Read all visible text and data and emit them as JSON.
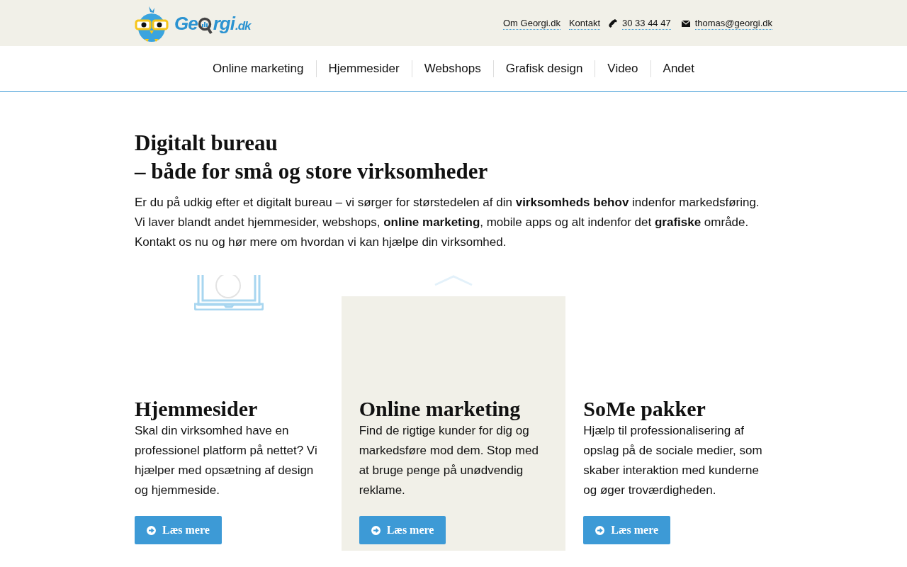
{
  "header": {
    "logo": {
      "before": "Ge",
      "after": "rgi",
      "suffix": ".dk"
    },
    "links": [
      {
        "kind": "link",
        "label": "Om Georgi.dk"
      },
      {
        "kind": "link",
        "label": "Kontakt"
      },
      {
        "kind": "phone",
        "label": "30 33 44 47"
      },
      {
        "kind": "email",
        "label": "thomas@georgi.dk"
      }
    ]
  },
  "nav": [
    "Online marketing",
    "Hjemmesider",
    "Webshops",
    "Grafisk design",
    "Video",
    "Andet"
  ],
  "intro": {
    "title_lines": [
      "Digitalt bureau",
      "– både for små og store virksomheder"
    ],
    "text": "Er du på udkig efter et digitalt bureau – vi sørger for størstedelen af din **virksomheds behov** indenfor markedsføring. Vi laver blandt andet hjemmesider, webshops, **online marketing**, mobile apps og alt indenfor det **grafiske** område. Kontakt os nu og hør mere om hvordan vi kan hjælpe din virksomhed."
  },
  "cards": [
    {
      "kind": "laptop",
      "highlighted": false,
      "title": "Hjemmesider",
      "text": "Skal din virksomhed have en professionel platform på nettet? Vi hjælper med opsætning af design og hjemmeside.",
      "button": "Læs mere"
    },
    {
      "kind": "chevron",
      "highlighted": true,
      "title": "Online marketing",
      "text": "Find de rigtige kunder for dig og markedsføre mod dem. Stop med at bruge penge på unødvendig reklame.",
      "button": "Læs mere"
    },
    {
      "kind": "plain",
      "highlighted": false,
      "title": "SoMe pakker",
      "text": "Hjælp til professionalisering af opslag på de sociale medier, som skaber interaktion med kunderne og øger troværdigheden.",
      "button": "Læs mere"
    }
  ]
}
